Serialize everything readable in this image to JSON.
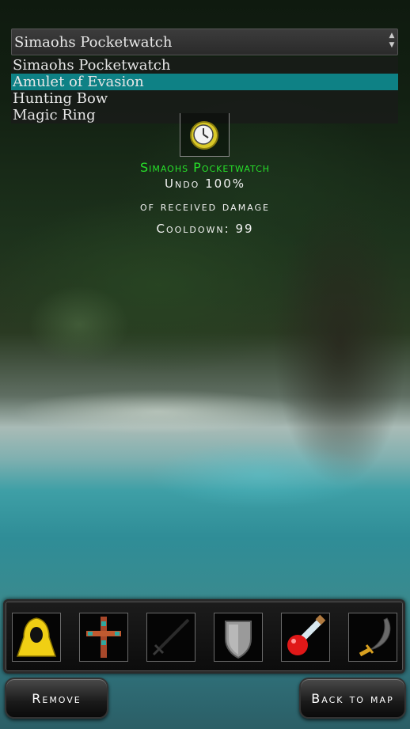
{
  "dropdown": {
    "selected_value": "Simaohs Pocketwatch",
    "options": [
      "Simaohs Pocketwatch",
      "Amulet of Evasion",
      "Hunting Bow",
      "Magic Ring"
    ],
    "highlighted_index": 1,
    "highlight_color": "#0e8185"
  },
  "item": {
    "icon": "pocketwatch-icon",
    "name": "Simaohs Pocketwatch",
    "name_color": "#27e02a",
    "lines": [
      "Undo 100%",
      "of received damage",
      "Cooldown: 99"
    ]
  },
  "inventory": {
    "slots": [
      "hooded-cloak-icon",
      "totem-cross-icon",
      "sword-icon",
      "shield-icon",
      "potion-icon",
      "scimitar-icon"
    ]
  },
  "buttons": {
    "remove": "Remove",
    "back_to_map": "Back to map"
  }
}
